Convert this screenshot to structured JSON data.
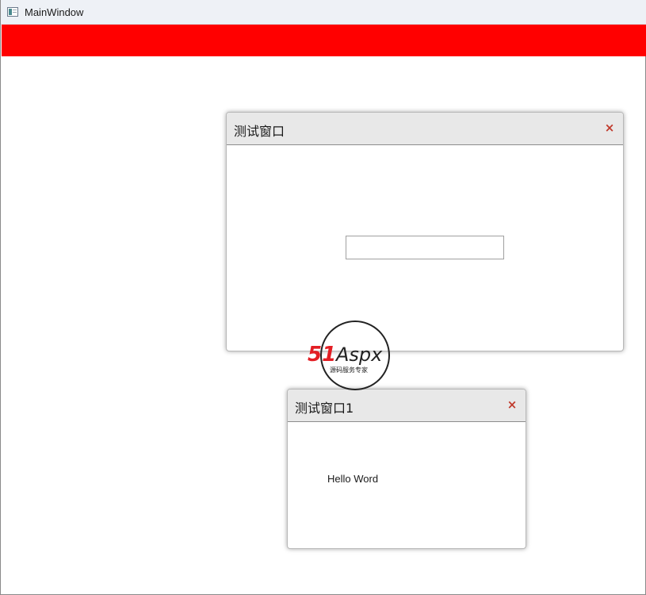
{
  "window": {
    "title": "MainWindow",
    "icon": "app-window-icon"
  },
  "banner": {
    "color": "#ff0000"
  },
  "dialogs": [
    {
      "title": "测试窗口",
      "close_label": "×",
      "input_value": ""
    },
    {
      "title": "测试窗口1",
      "close_label": "×",
      "text": "Hello Word"
    }
  ],
  "watermark": {
    "brand": "51Aspx",
    "tagline": "源码服务专家"
  },
  "colors": {
    "close_icon": "#c0392b",
    "dialog_header": "#e8e8e8"
  }
}
